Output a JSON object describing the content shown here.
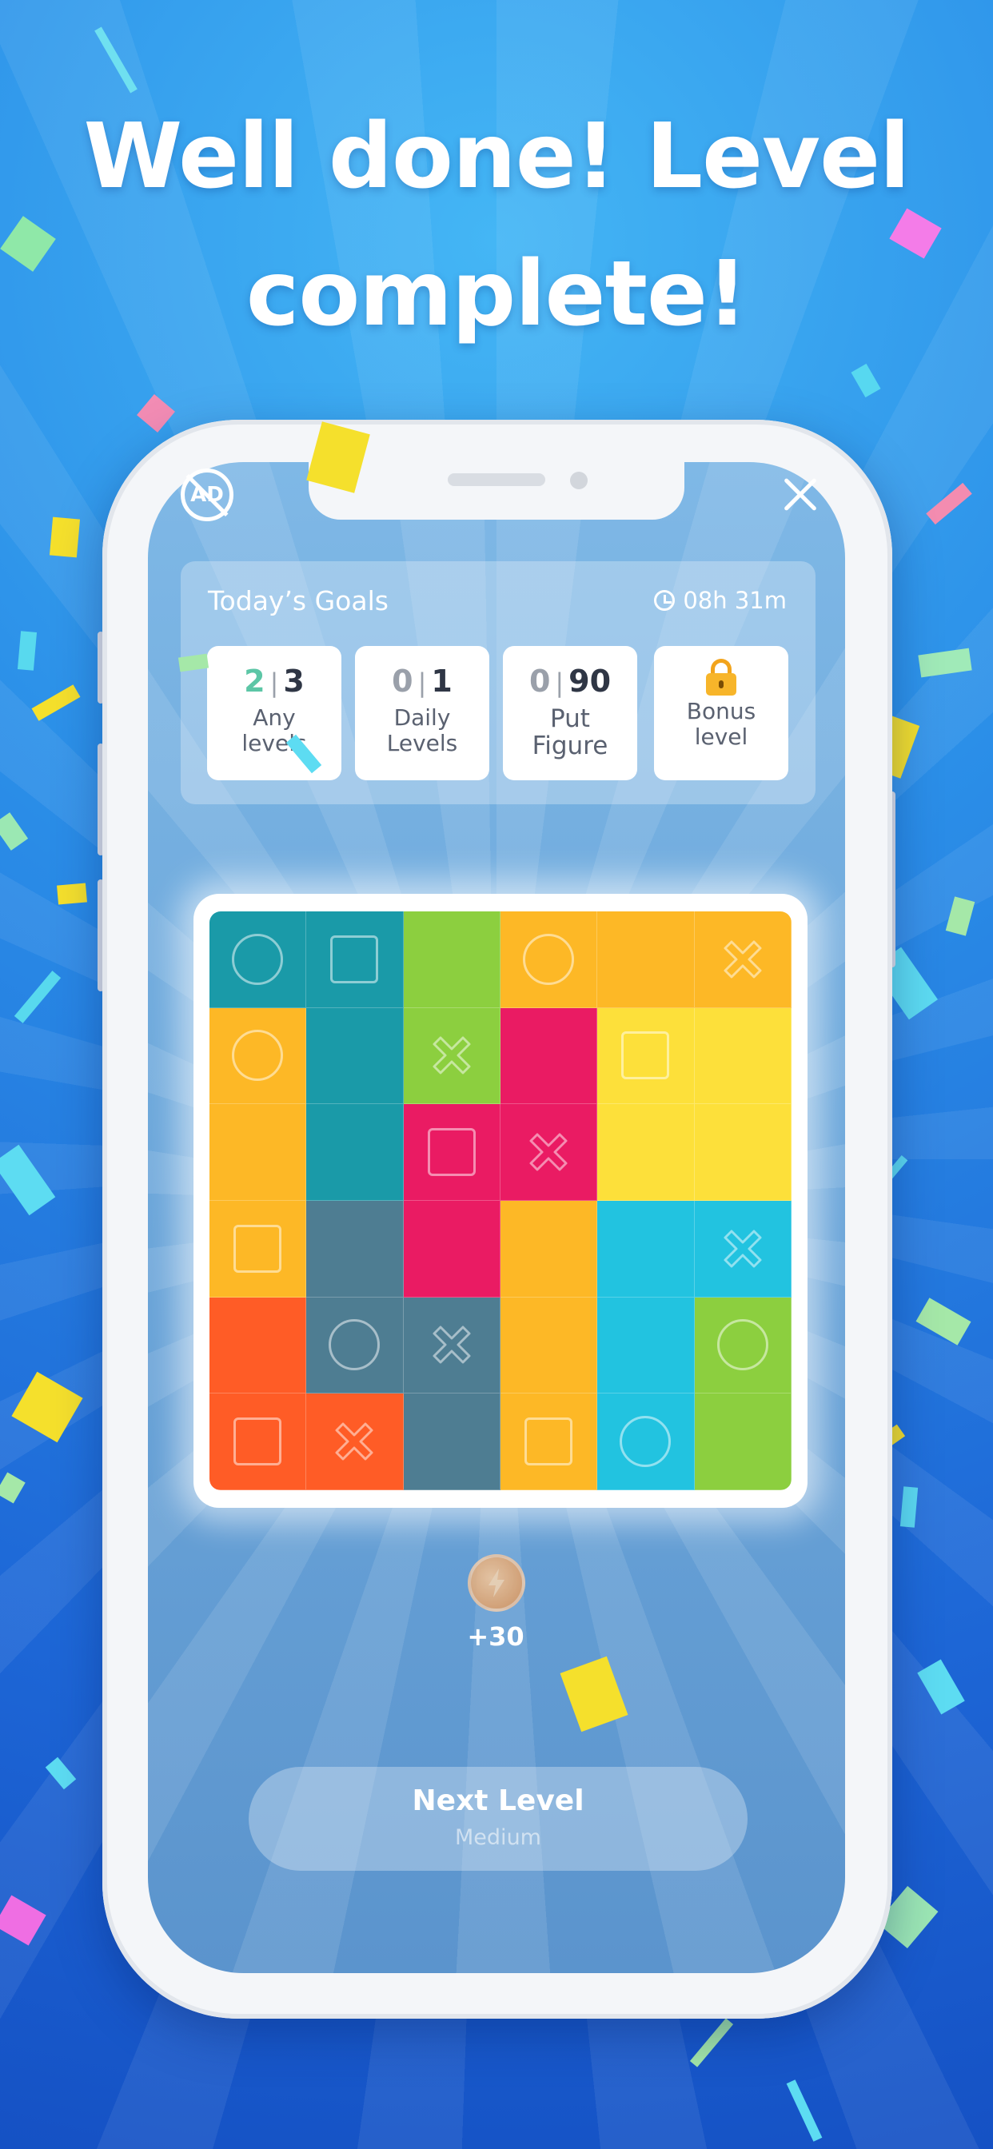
{
  "headline": "Well done! Level complete!",
  "header": {
    "ad_label": "AD"
  },
  "goals": {
    "title": "Today’s Goals",
    "timer": "08h 31m",
    "cards": [
      {
        "done": "2",
        "total": "3",
        "label_line1": "Any",
        "label_line2": "levels"
      },
      {
        "done": "0",
        "total": "1",
        "label_line1": "Daily",
        "label_line2": "Levels"
      },
      {
        "done": "0",
        "total": "90",
        "label_line1": "Put",
        "label_line2": "Figure"
      },
      {
        "label_line1": "Bonus",
        "label_line2": "level",
        "icon": "lock-icon"
      }
    ]
  },
  "board": {
    "colors": {
      "teal": "#1a9aa8",
      "green": "#8ccf3f",
      "orange": "#fdb826",
      "yellow": "#fde03a",
      "magenta": "#ea1b63",
      "slate": "#4e7d92",
      "cyan": "#22c3e0",
      "red_orange": "#ff5c26"
    },
    "rows": [
      [
        {
          "c": "teal",
          "s": "circle"
        },
        {
          "c": "teal",
          "s": "square"
        },
        {
          "c": "green",
          "s": ""
        },
        {
          "c": "orange",
          "s": "circle"
        },
        {
          "c": "orange",
          "s": ""
        },
        {
          "c": "orange",
          "s": "cross"
        }
      ],
      [
        {
          "c": "orange",
          "s": "circle"
        },
        {
          "c": "teal",
          "s": ""
        },
        {
          "c": "green",
          "s": "cross"
        },
        {
          "c": "magenta",
          "s": ""
        },
        {
          "c": "yellow",
          "s": "square"
        },
        {
          "c": "yellow",
          "s": ""
        }
      ],
      [
        {
          "c": "orange",
          "s": ""
        },
        {
          "c": "teal",
          "s": ""
        },
        {
          "c": "magenta",
          "s": "square"
        },
        {
          "c": "magenta",
          "s": "cross"
        },
        {
          "c": "yellow",
          "s": ""
        },
        {
          "c": "yellow",
          "s": ""
        }
      ],
      [
        {
          "c": "orange",
          "s": "square"
        },
        {
          "c": "slate",
          "s": ""
        },
        {
          "c": "magenta",
          "s": ""
        },
        {
          "c": "orange",
          "s": ""
        },
        {
          "c": "cyan",
          "s": ""
        },
        {
          "c": "cyan",
          "s": "cross"
        }
      ],
      [
        {
          "c": "red_orange",
          "s": ""
        },
        {
          "c": "slate",
          "s": "circle"
        },
        {
          "c": "slate",
          "s": "cross"
        },
        {
          "c": "orange",
          "s": ""
        },
        {
          "c": "cyan",
          "s": ""
        },
        {
          "c": "green",
          "s": "circle"
        }
      ],
      [
        {
          "c": "red_orange",
          "s": "square"
        },
        {
          "c": "red_orange",
          "s": "cross"
        },
        {
          "c": "slate",
          "s": ""
        },
        {
          "c": "orange",
          "s": "square"
        },
        {
          "c": "cyan",
          "s": "circle"
        },
        {
          "c": "green",
          "s": ""
        }
      ]
    ]
  },
  "reward": {
    "icon": "lightning-coin-icon",
    "amount": "+30"
  },
  "next_button": {
    "label": "Next Level",
    "difficulty": "Medium"
  }
}
